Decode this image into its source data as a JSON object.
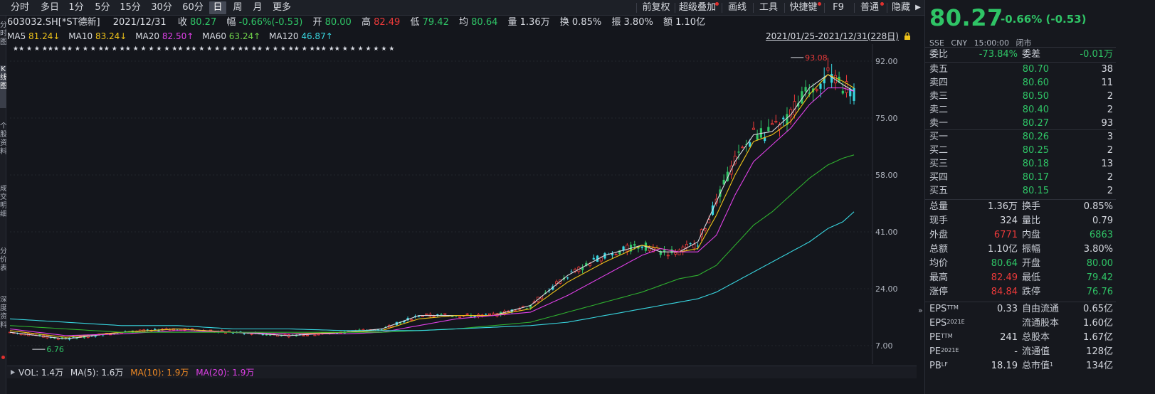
{
  "toolbar": {
    "periods": [
      "分时",
      "多日",
      "1分",
      "5分",
      "15分",
      "30分",
      "60分",
      "日",
      "周",
      "月",
      "更多"
    ],
    "active_period": "日",
    "right_tools": [
      "前复权",
      "超级叠加",
      "画线",
      "工具",
      "快捷键",
      "F9",
      "普通",
      "隐藏"
    ]
  },
  "left_strip": [
    "分时图",
    "K线图",
    "个股资料",
    "成交明细",
    "分价表",
    "深度资料"
  ],
  "info": {
    "code_name": "603032.SH[*ST德新]",
    "date": "2021/12/31",
    "close_label": "收",
    "close": "80.27",
    "amp_label": "幅",
    "change": "-0.66%(-0.53)",
    "open_label": "开",
    "open": "80.00",
    "high_label": "高",
    "high": "82.49",
    "low_label": "低",
    "low": "79.42",
    "avg_label": "均",
    "avg": "80.64",
    "vol_label": "量",
    "volume": "1.36万",
    "turn_label": "换",
    "turnover": "0.85%",
    "swing_label": "振",
    "swing": "3.80%",
    "amt_label": "额",
    "amount": "1.10亿"
  },
  "ma": {
    "ma5": "MA5",
    "ma5_val": "81.24↓",
    "ma10": "MA10",
    "ma10_val": "83.24↓",
    "ma20": "MA20",
    "ma20_val": "82.50↑",
    "ma60": "MA60",
    "ma60_val": "63.24↑",
    "ma120": "MA120",
    "ma120_val": "46.87↑"
  },
  "date_range": "2021/01/25-2021/12/31(228日)",
  "colors": {
    "up": "#ee3a3a",
    "down": "#2fc466",
    "cyan_candle": "#38d6e0",
    "ma5": "#d8dbe2",
    "ma10": "#f0c419",
    "ma20": "#e040e8",
    "ma60": "#2fb02f",
    "ma120": "#38d6e0",
    "bg": "#14161c"
  },
  "chart_data": {
    "type": "line",
    "y_ticks": [
      "92.00",
      "75.00",
      "58.00",
      "41.00",
      "24.00",
      "7.00"
    ],
    "ylim": [
      1,
      98
    ],
    "annotations": {
      "high_label": "93.08",
      "low_label": "6.76"
    },
    "star_markers": "★★ ★ ★ ★★★ ★★ ★ ★ ★ ★★ ★ ★★ ★ ★ ★ ★ ★ ★★ ★★ ★ ★ ★ ★ ★ ★★ ★★ ★ ★ ★ ★★ ★ ★★★ ★★ ★ ★ ★ ★ ★ ★ ★",
    "x_index": [
      0,
      15,
      30,
      45,
      60,
      75,
      90,
      100,
      110,
      120,
      130,
      140,
      150,
      160,
      170,
      175,
      180,
      185,
      190,
      195,
      200,
      205,
      210,
      215,
      220,
      224,
      227
    ],
    "series": [
      {
        "name": "MA5",
        "values": [
          11,
          9,
          11,
          12,
          11,
          10,
          11,
          12,
          16,
          16,
          16,
          19,
          28,
          34,
          37,
          35,
          35,
          38,
          50,
          62,
          70,
          71,
          76,
          84,
          88,
          85,
          83
        ]
      },
      {
        "name": "MA10",
        "values": [
          11.5,
          9.5,
          11,
          12,
          11,
          10.5,
          11,
          11.5,
          15,
          16,
          16,
          18,
          26,
          32,
          37,
          36,
          35,
          36,
          46,
          58,
          68,
          70,
          74,
          82,
          88,
          86,
          84
        ]
      },
      {
        "name": "MA20",
        "values": [
          12,
          10,
          10.5,
          11.5,
          11,
          10.5,
          10.5,
          11,
          13,
          15,
          16,
          17,
          22,
          28,
          34,
          36,
          35,
          35,
          40,
          52,
          62,
          67,
          72,
          79,
          84,
          84,
          83
        ]
      },
      {
        "name": "MA60",
        "values": [
          13,
          12,
          11,
          11,
          11,
          11,
          11,
          11,
          11.5,
          12,
          13,
          14,
          17,
          20,
          23,
          25,
          27,
          28,
          31,
          37,
          43,
          47,
          52,
          57,
          61,
          63,
          64
        ]
      },
      {
        "name": "MA120",
        "values": [
          15,
          14,
          13,
          13,
          12,
          12,
          11.5,
          11.5,
          11.5,
          12,
          12.5,
          13,
          14,
          16,
          18,
          19,
          20,
          21,
          23,
          26,
          29,
          32,
          35,
          38,
          42,
          44,
          47
        ]
      }
    ]
  },
  "vol": {
    "vol_label": "VOL: 1.4万",
    "ma5_label": "MA(5): 1.6万",
    "ma10_label": "MA(10): 1.9万",
    "ma20_label": "MA(20): 1.9万"
  },
  "quote": {
    "price": "80.27",
    "change": "-0.66% (-0.53)",
    "market": "SSE",
    "currency": "CNY",
    "time": "15:00:00",
    "status": "闭市",
    "weibi_label": "委比",
    "weibi": "-73.84%",
    "weicha_label": "委差",
    "weicha": "-0.01万",
    "asks": [
      {
        "label": "卖五",
        "price": "80.70",
        "qty": "38"
      },
      {
        "label": "卖四",
        "price": "80.60",
        "qty": "11"
      },
      {
        "label": "卖三",
        "price": "80.50",
        "qty": "2"
      },
      {
        "label": "卖二",
        "price": "80.40",
        "qty": "2"
      },
      {
        "label": "卖一",
        "price": "80.27",
        "qty": "93"
      }
    ],
    "bids": [
      {
        "label": "买一",
        "price": "80.26",
        "qty": "3"
      },
      {
        "label": "买二",
        "price": "80.25",
        "qty": "2"
      },
      {
        "label": "买三",
        "price": "80.18",
        "qty": "13"
      },
      {
        "label": "买四",
        "price": "80.17",
        "qty": "2"
      },
      {
        "label": "买五",
        "price": "80.15",
        "qty": "2"
      }
    ],
    "stats": [
      {
        "l1": "总量",
        "v1": "1.36万",
        "l2": "换手",
        "v2": "0.85%"
      },
      {
        "l1": "现手",
        "v1": "324",
        "l2": "量比",
        "v2": "0.79"
      },
      {
        "l1": "外盘",
        "v1": "6771",
        "l2": "内盘",
        "v2": "6863"
      },
      {
        "l1": "总额",
        "v1": "1.10亿",
        "l2": "振幅",
        "v2": "3.80%"
      },
      {
        "l1": "均价",
        "v1": "80.64",
        "l2": "开盘",
        "v2": "80.00"
      },
      {
        "l1": "最高",
        "v1": "82.49",
        "l2": "最低",
        "v2": "79.42"
      },
      {
        "l1": "涨停",
        "v1": "84.84",
        "l2": "跌停",
        "v2": "76.76"
      }
    ],
    "fundamentals": [
      {
        "l1": "EPS",
        "s1": "TTM",
        "v1": "0.33",
        "l2": "自由流通",
        "s2": "",
        "v2": "0.65亿"
      },
      {
        "l1": "EPS",
        "s1": "2021E",
        "v1": "",
        "l2": "流通股本",
        "s2": "",
        "v2": "1.60亿"
      },
      {
        "l1": "PE",
        "s1": "TTM",
        "v1": "241",
        "l2": "总股本",
        "s2": "",
        "v2": "1.67亿"
      },
      {
        "l1": "PE",
        "s1": "2021E",
        "v1": "-",
        "l2": "流通值",
        "s2": "",
        "v2": "128亿"
      },
      {
        "l1": "PB",
        "s1": "LF",
        "v1": "18.19",
        "l2": "总市值",
        "s2": "1",
        "v2": "134亿"
      }
    ]
  }
}
